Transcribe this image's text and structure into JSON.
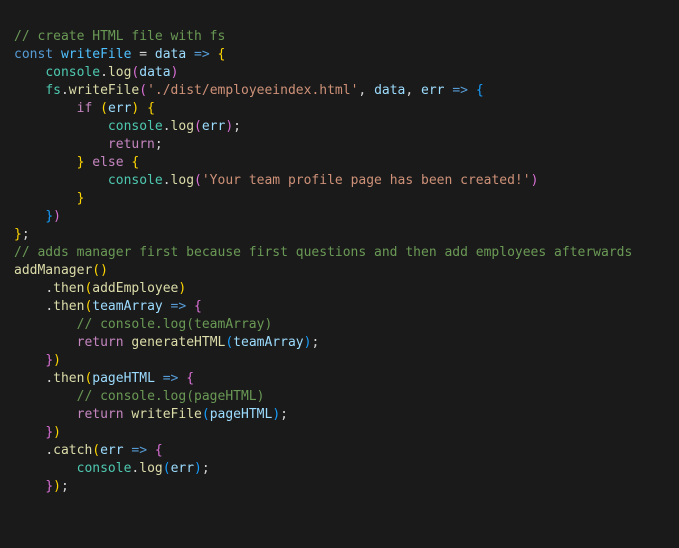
{
  "code": {
    "l1": "// create HTML file with fs",
    "l2_const": "const",
    "l2_name": "writeFile",
    "l2_eq": " = ",
    "l2_param": "data",
    "l2_arrow": " => ",
    "l2_brace": "{",
    "l3_obj": "console",
    "l3_dot": ".",
    "l3_fn": "log",
    "l3_op": "(",
    "l3_arg": "data",
    "l3_cp": ")",
    "l4_fs": "fs",
    "l4_dot": ".",
    "l4_fn": "writeFile",
    "l4_op": "(",
    "l4_str": "'./dist/employeeindex.html'",
    "l4_c1": ", ",
    "l4_arg1": "data",
    "l4_c2": ", ",
    "l4_arg2": "err",
    "l4_arrow": " => ",
    "l4_brace": "{",
    "l5_if": "if",
    "l5_sp": " ",
    "l5_op": "(",
    "l5_err": "err",
    "l5_cp": ")",
    "l5_sp2": " ",
    "l5_brace": "{",
    "l6_obj": "console",
    "l6_dot": ".",
    "l6_fn": "log",
    "l6_op": "(",
    "l6_arg": "err",
    "l6_cp": ")",
    "l6_semi": ";",
    "l7_ret": "return",
    "l7_semi": ";",
    "l8_cb": "}",
    "l8_else": " else ",
    "l8_ob": "{",
    "l9_obj": "console",
    "l9_dot": ".",
    "l9_fn": "log",
    "l9_op": "(",
    "l9_str": "'Your team profile page has been created!'",
    "l9_cp": ")",
    "l10_cb": "}",
    "l11_cb": "}",
    "l11_cp": ")",
    "l12_cb": "}",
    "l12_semi": ";",
    "l13": "// adds manager first because first questions and then add employees afterwards",
    "l14_fn": "addManager",
    "l14_op": "(",
    "l14_cp": ")",
    "l15_dot": ".",
    "l15_fn": "then",
    "l15_op": "(",
    "l15_arg": "addEmployee",
    "l15_cp": ")",
    "l16_dot": ".",
    "l16_fn": "then",
    "l16_op": "(",
    "l16_param": "teamArray",
    "l16_arrow": " => ",
    "l16_brace": "{",
    "l17": "// console.log(teamArray)",
    "l18_ret": "return",
    "l18_sp": " ",
    "l18_fn": "generateHTML",
    "l18_op": "(",
    "l18_arg": "teamArray",
    "l18_cp": ")",
    "l18_semi": ";",
    "l19_cb": "}",
    "l19_cp": ")",
    "l20_dot": ".",
    "l20_fn": "then",
    "l20_op": "(",
    "l20_param": "pageHTML",
    "l20_arrow": " => ",
    "l20_brace": "{",
    "l21": "// console.log(pageHTML)",
    "l22_ret": "return",
    "l22_sp": " ",
    "l22_fn": "writeFile",
    "l22_op": "(",
    "l22_arg": "pageHTML",
    "l22_cp": ")",
    "l22_semi": ";",
    "l23_cb": "}",
    "l23_cp": ")",
    "l24_dot": ".",
    "l24_fn": "catch",
    "l24_op": "(",
    "l24_param": "err",
    "l24_arrow": " => ",
    "l24_brace": "{",
    "l25_obj": "console",
    "l25_dot": ".",
    "l25_fn": "log",
    "l25_op": "(",
    "l25_arg": "err",
    "l25_cp": ")",
    "l25_semi": ";",
    "l26_cb": "}",
    "l26_cp": ")",
    "l26_semi": ";"
  }
}
